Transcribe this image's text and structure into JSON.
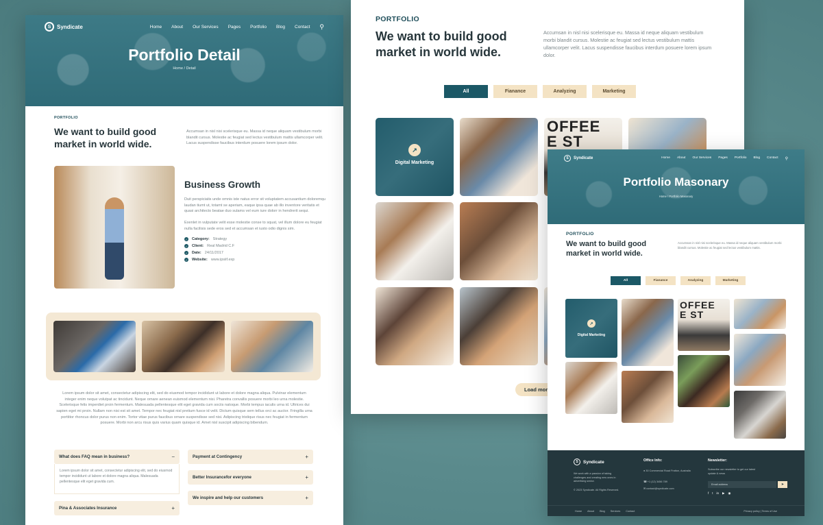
{
  "brand": {
    "name": "Syndicate"
  },
  "nav": {
    "items": [
      "Home",
      "About",
      "Our Services",
      "Pages",
      "Portfolio",
      "Blog",
      "Contact"
    ]
  },
  "detail": {
    "hero_title": "Portfolio Detail",
    "breadcrumb": "Home / Detail",
    "eyebrow": "PORTFOLIO",
    "heading": "We want to build good market in world wide.",
    "intro": "Accumsan in nisl nisi scelerisque eu. Massa id neque aliquam vestibulum morbi blandit cursus. Molestie ac feugiat sed lectus vestibulum mattis ullamcorper velit. Lacus suspendisse faucibus interdum posuere lorem ipsum dolor.",
    "section_title": "Business Growth",
    "paragraph1": "Duit perspiciatis unde omnis iste natus error sit voluptatem accusantium doloremqu laudan tiumt ut, totamt se aperiam, eaque ipsa quae ab illo inventore veritatis et quasi architecto beatae duo sulams vel eum iure dolorr in hendrerit sequi.",
    "paragraph2": "Exenlet in vulputate velit esse molestie conse to squat, vel illum dolore eu feugiat nulla facilisis sede eros sed et accumsan et iusto odio dignis sim.",
    "meta": [
      {
        "label": "Category:",
        "value": "Strategy"
      },
      {
        "label": "Client:",
        "value": "Real Madrid C.F"
      },
      {
        "label": "Date:",
        "value": "24/11/2017"
      },
      {
        "label": "Website:",
        "value": "www.ipsiif.exp"
      }
    ],
    "long_text": "Lorem ipsum dolor sit amet, consectetur adipiscing elit, sed do eiusmod tempor incididunt ut labore et dolore magna aliqua. Pulvinar elementum integer enim neque volutpat ac tincidunt. Neque ornare aenean euismod elementum nisi. Pharetra convallis posuere morbi leo urna molestie. Scelerisque felis imperdiet proin fermentum. Malesuada pellentesque elit eget gravida cum sociis natoque. Morbi tempus iaculis urna id. Ultrices dui sapien eget mi proin. Nullam non nisi est sit amet. Tempor nec feugiat nisl pretium fusce id velit. Dictum quisque sem tellus orci ac auctor. Fringilla urna porttitor rhoncus dolor purus non enim. Tortor vitae purus faucibus ornare suspendisse sed nisi. Adipiscing tristique risus nec feugiat in fermentum posuere. Morbi non arcu risus quis varius quam quisque id. Amet nisl suscipit adipiscing bibendum.",
    "faq": [
      {
        "q": "What does FAQ mean in business?",
        "open": true,
        "a": "Lorem ipsum dolor sit amet, consectetur adipiscing elit, sed do eiusmod tempor incididunt ut labore et dolore magna aliqua. Malesuada pellentesque elit eget gravida cum."
      },
      {
        "q": "Pina & Associates Insurance",
        "open": false
      },
      {
        "q": "Payment at Contingency",
        "open": false
      },
      {
        "q": "Better Insurancefor everyone",
        "open": false
      },
      {
        "q": "We inspire and help our customers",
        "open": false
      }
    ]
  },
  "portfolio": {
    "eyebrow": "PORTFOLIO",
    "heading": "We want to build good market in world wide.",
    "intro": "Accumsan in nisl nisi scelerisque eu. Massa id neque aliquam vestibulum morbi blandit cursus. Molestie ac feugiat sed lectus vestibulum mattis ullamcorper velit. Lacus suspendisse faucibus interdum posuere lorem ipsum dolor.",
    "filters": [
      "All",
      "Fianance",
      "Analyzing",
      "Marketing"
    ],
    "active_filter": "All",
    "featured_label": "Digital Marketing",
    "load_more": "Load more"
  },
  "masonry": {
    "hero_title": "Portfolio Masonary",
    "breadcrumb": "Home / Portfolio Masonary",
    "eyebrow": "PORTFOLIO",
    "heading": "We want to build good market in world wide.",
    "intro": "Accumsan in nisl nisi scelerisque eu. Massa id neque aliquam vestibulum morbi blandit cursus. Molestie ac feugiat sed lectus vestibulum mattis.",
    "filters": [
      "All",
      "Fianance",
      "Analyzing",
      "Marketing"
    ],
    "featured_label": "Digital Marketing",
    "footer": {
      "about": "We work with a passion of taking challenges and creating new ones in advertising sector.",
      "copyright": "© 2023 Syndicate. All Rights Reserved.",
      "office_title": "Office Info:",
      "address": "30 Commercial Road Fratton, Australia",
      "phone": "+1 (12) 3456 789",
      "email": "contact@syndicate.com",
      "newsletter_title": "Newsletter:",
      "newsletter_text": "Subscribe our newsletter to get our latest update & news",
      "email_placeholder": "Email address",
      "links": [
        "Home",
        "About",
        "Blog",
        "Services",
        "Contact"
      ],
      "legal": "Privacy policy | Terms of Use"
    }
  },
  "colors": {
    "primary": "#1b5866",
    "accent": "#f4e3c4",
    "dark": "#24373d"
  }
}
